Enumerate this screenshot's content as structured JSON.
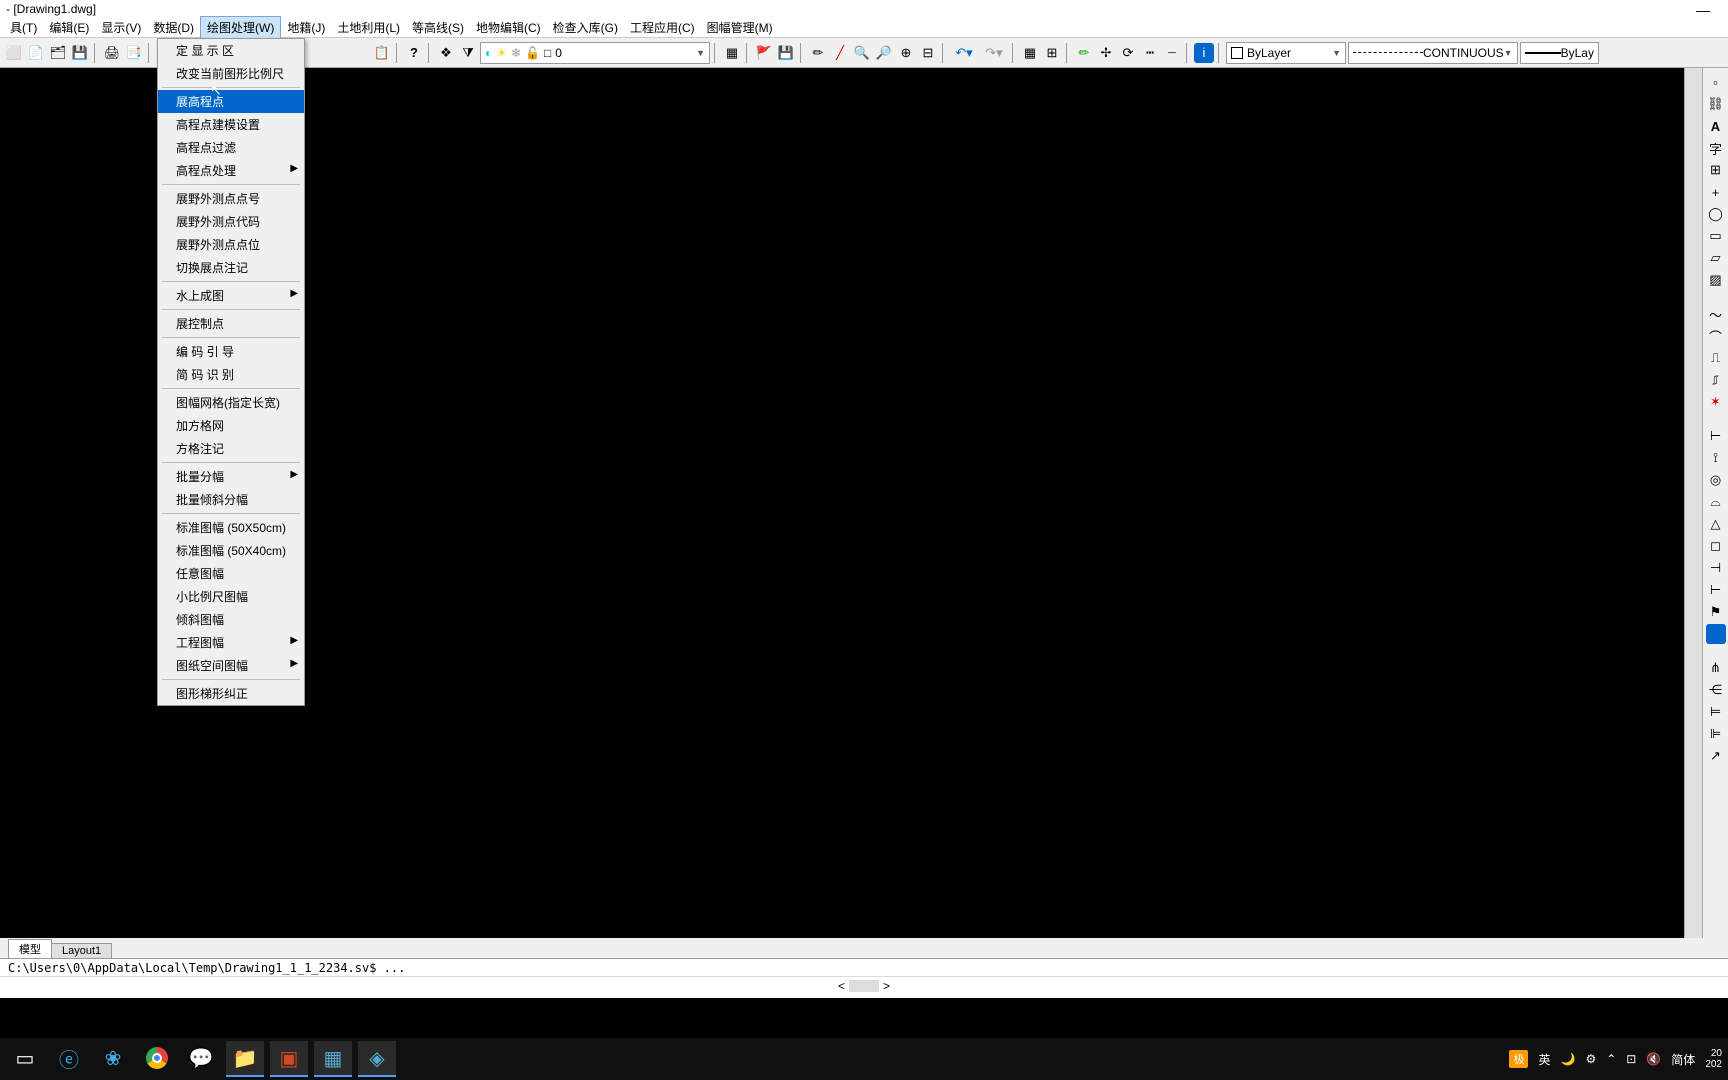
{
  "title": "- [Drawing1.dwg]",
  "menuBar": [
    {
      "id": "tool",
      "label": "具(T)"
    },
    {
      "id": "edit",
      "label": "编辑(E)"
    },
    {
      "id": "display",
      "label": "显示(V)"
    },
    {
      "id": "data",
      "label": "数据(D)"
    },
    {
      "id": "draw",
      "label": "绘图处理(W)",
      "active": true
    },
    {
      "id": "cadastre",
      "label": "地籍(J)"
    },
    {
      "id": "land",
      "label": "土地利用(L)"
    },
    {
      "id": "contour",
      "label": "等高线(S)"
    },
    {
      "id": "topo",
      "label": "地物编辑(C)"
    },
    {
      "id": "check",
      "label": "检查入库(G)"
    },
    {
      "id": "eng",
      "label": "工程应用(C)"
    },
    {
      "id": "sheet",
      "label": "图幅管理(M)"
    }
  ],
  "dropdown": {
    "groups": [
      [
        "定 显 示 区",
        "改变当前图形比例尺"
      ],
      [
        {
          "label": "展高程点",
          "hl": true
        },
        "高程点建模设置",
        "高程点过滤",
        {
          "label": "高程点处理",
          "sub": true
        }
      ],
      [
        "展野外测点点号",
        "展野外测点代码",
        "展野外测点点位",
        "切换展点注记"
      ],
      [
        {
          "label": "水上成图",
          "sub": true
        }
      ],
      [
        "展控制点"
      ],
      [
        "编 码 引 导",
        "简 码 识 别"
      ],
      [
        "图幅网格(指定长宽)",
        "加方格网",
        "方格注记"
      ],
      [
        {
          "label": "批量分幅",
          "sub": true
        },
        "批量倾斜分幅"
      ],
      [
        "标准图幅 (50X50cm)",
        "标准图幅 (50X40cm)",
        "任意图幅",
        "小比例尺图幅",
        "倾斜图幅",
        {
          "label": "工程图幅",
          "sub": true
        },
        {
          "label": "图纸空间图幅",
          "sub": true
        }
      ],
      [
        "图形梯形纠正"
      ]
    ]
  },
  "layerCombo": {
    "layer": "0"
  },
  "styleByLayer": "ByLayer",
  "styleContinuous": "CONTINUOUS",
  "styleByLa": "ByLay",
  "tabs": {
    "model": "模型",
    "layout": "Layout1"
  },
  "commandText": "C:\\Users\\0\\AppData\\Local\\Temp\\Drawing1_1_1_2234.sv$ ...",
  "tray": {
    "ime": "极",
    "eng": "英",
    "lang": "简体",
    "year": "202",
    "net": "20"
  },
  "icons": {
    "lightbulb": "💡",
    "sun": "☀",
    "lock": "🔒",
    "square": "□",
    "undo": "↶",
    "redo": "↷"
  }
}
